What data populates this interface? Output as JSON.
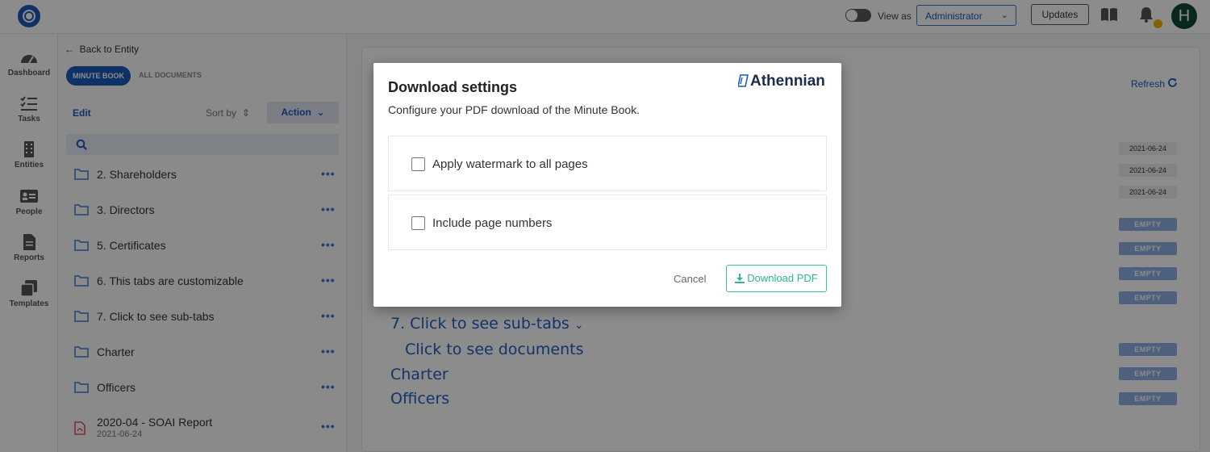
{
  "topbar": {
    "view_as_label": "View as",
    "role_selected": "Administrator",
    "updates_label": "Updates",
    "avatar_initial": "H"
  },
  "sidenav": {
    "items": [
      {
        "label": "Dashboard"
      },
      {
        "label": "Tasks"
      },
      {
        "label": "Entities"
      },
      {
        "label": "People"
      },
      {
        "label": "Reports"
      },
      {
        "label": "Templates"
      }
    ]
  },
  "leftpanel": {
    "back_label": "Back to Entity",
    "tabs": [
      {
        "label": "MINUTE BOOK",
        "active": true
      },
      {
        "label": "ALL DOCUMENTS",
        "active": false
      }
    ],
    "edit_label": "Edit",
    "sortby_label": "Sort by",
    "action_label": "Action",
    "folders": [
      {
        "label": "2. Shareholders"
      },
      {
        "label": "3. Directors"
      },
      {
        "label": "5. Certificates"
      },
      {
        "label": "6. This tabs are customizable"
      },
      {
        "label": "7. Click to see sub-tabs"
      },
      {
        "label": "Charter"
      },
      {
        "label": "Officers"
      }
    ],
    "document": {
      "title": "2020-04 - SOAI Report",
      "date": "2021-06-24"
    },
    "more_glyph": "•••"
  },
  "main": {
    "refresh_label": "Refresh",
    "date_badges": [
      "2021-06-24",
      "2021-06-24",
      "2021-06-24"
    ],
    "empty_label": "EMPTY",
    "tree": [
      {
        "label": "7. Click to see sub-tabs"
      },
      {
        "label": "Click to see documents"
      },
      {
        "label": "Charter"
      },
      {
        "label": "Officers"
      }
    ]
  },
  "modal": {
    "title": "Download settings",
    "subtitle": "Configure your PDF download of the Minute Book.",
    "brand": "Athennian",
    "options": [
      {
        "label": "Apply watermark to all pages",
        "checked": false
      },
      {
        "label": "Include page numbers",
        "checked": false
      }
    ],
    "cancel_label": "Cancel",
    "download_label": "Download PDF"
  },
  "colors": {
    "primary": "#1a5bb8",
    "accent_green": "#36c69e",
    "empty_badge": "#8fb0e3"
  }
}
